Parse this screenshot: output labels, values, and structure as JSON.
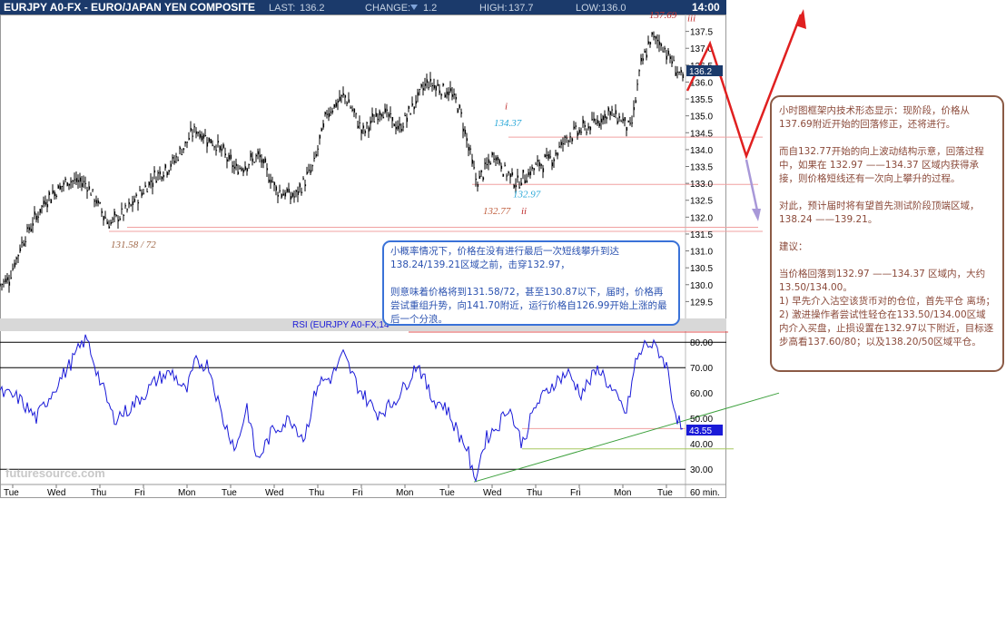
{
  "header": {
    "title": "EURJPY A0-FX - EURO/JAPAN YEN COMPOSITE",
    "last_label": "LAST:",
    "last": "136.2",
    "change_label": "CHANGE:",
    "change": "1.2",
    "high_label": "HIGH:",
    "high": "137.7",
    "low_label": "LOW:",
    "low": "136.0",
    "time": "14:00"
  },
  "chart_data": [
    {
      "type": "candlestick",
      "title": "EURJPY A0-FX - EURO/JAPAN YEN COMPOSITE",
      "ylim": [
        129.0,
        138.0
      ],
      "y_ticks": [
        "137.5",
        "137.0",
        "136.5",
        "136.0",
        "135.5",
        "135.0",
        "134.5",
        "134.0",
        "133.5",
        "133.0",
        "132.5",
        "132.0",
        "131.5",
        "131.0",
        "130.5",
        "130.0",
        "129.5"
      ],
      "last_price": "136.2",
      "path": [
        {
          "i": 0,
          "y": 130.0
        },
        {
          "i": 10,
          "y": 130.2
        },
        {
          "i": 25,
          "y": 131.3
        },
        {
          "i": 50,
          "y": 132.5
        },
        {
          "i": 75,
          "y": 133.1
        },
        {
          "i": 95,
          "y": 133.0
        },
        {
          "i": 120,
          "y": 131.8
        },
        {
          "i": 140,
          "y": 132.2
        },
        {
          "i": 170,
          "y": 133.2
        },
        {
          "i": 190,
          "y": 133.6
        },
        {
          "i": 215,
          "y": 134.6
        },
        {
          "i": 240,
          "y": 134.1
        },
        {
          "i": 260,
          "y": 133.4
        },
        {
          "i": 285,
          "y": 133.8
        },
        {
          "i": 305,
          "y": 132.8
        },
        {
          "i": 325,
          "y": 132.6
        },
        {
          "i": 345,
          "y": 133.5
        },
        {
          "i": 360,
          "y": 135.1
        },
        {
          "i": 380,
          "y": 135.6
        },
        {
          "i": 400,
          "y": 134.5
        },
        {
          "i": 420,
          "y": 135.2
        },
        {
          "i": 440,
          "y": 134.6
        },
        {
          "i": 470,
          "y": 136.0
        },
        {
          "i": 495,
          "y": 135.7
        },
        {
          "i": 505,
          "y": 135.3
        },
        {
          "i": 515,
          "y": 134.2
        },
        {
          "i": 525,
          "y": 133.0
        },
        {
          "i": 545,
          "y": 133.9
        },
        {
          "i": 555,
          "y": 133.4
        },
        {
          "i": 570,
          "y": 133.0
        },
        {
          "i": 590,
          "y": 133.5
        },
        {
          "i": 610,
          "y": 133.8
        },
        {
          "i": 625,
          "y": 134.4
        },
        {
          "i": 650,
          "y": 134.7
        },
        {
          "i": 670,
          "y": 135.1
        },
        {
          "i": 685,
          "y": 134.9
        },
        {
          "i": 695,
          "y": 134.6
        },
        {
          "i": 705,
          "y": 136.4
        },
        {
          "i": 717,
          "y": 137.3
        },
        {
          "i": 727,
          "y": 137.2
        },
        {
          "i": 740,
          "y": 136.6
        },
        {
          "i": 752,
          "y": 136.1
        }
      ],
      "h_levels": [
        134.37,
        132.97,
        131.7,
        131.58
      ],
      "annotations": [
        {
          "text": "i",
          "y": 135.3,
          "color": "#c03030"
        },
        {
          "text": "134.37",
          "y": 134.8,
          "color": "#2aa8d8"
        },
        {
          "text": "132.97",
          "y": 132.7,
          "color": "#2aa8d8"
        },
        {
          "text": "132.77",
          "y": 132.2,
          "color": "#c06040"
        },
        {
          "text": "ii",
          "y": 132.2,
          "color": "#c03030"
        },
        {
          "text": "131.58 / 72",
          "y": 131.2,
          "color": "#a06848"
        },
        {
          "text": "137.69",
          "y": 138.0,
          "color": "#c03030"
        },
        {
          "text": "iii",
          "y": 137.9,
          "color": "#c03030"
        }
      ]
    },
    {
      "type": "line",
      "title": "RSI (EURJPY A0-FX,14",
      "ylim": [
        24.0,
        84.0
      ],
      "y_ticks": [
        "80.00",
        "70.00",
        "60.00",
        "50.00",
        "40.00",
        "30.00"
      ],
      "last_value": "43.55",
      "path": [
        {
          "i": 0,
          "y": 60
        },
        {
          "i": 20,
          "y": 58
        },
        {
          "i": 40,
          "y": 50
        },
        {
          "i": 60,
          "y": 62
        },
        {
          "i": 75,
          "y": 70
        },
        {
          "i": 85,
          "y": 76
        },
        {
          "i": 95,
          "y": 82
        },
        {
          "i": 110,
          "y": 65
        },
        {
          "i": 125,
          "y": 50
        },
        {
          "i": 140,
          "y": 53
        },
        {
          "i": 160,
          "y": 60
        },
        {
          "i": 175,
          "y": 66
        },
        {
          "i": 190,
          "y": 68
        },
        {
          "i": 205,
          "y": 60
        },
        {
          "i": 215,
          "y": 72
        },
        {
          "i": 230,
          "y": 71
        },
        {
          "i": 245,
          "y": 50
        },
        {
          "i": 260,
          "y": 38
        },
        {
          "i": 272,
          "y": 55
        },
        {
          "i": 283,
          "y": 33
        },
        {
          "i": 300,
          "y": 45
        },
        {
          "i": 320,
          "y": 50
        },
        {
          "i": 335,
          "y": 42
        },
        {
          "i": 350,
          "y": 64
        },
        {
          "i": 365,
          "y": 66
        },
        {
          "i": 378,
          "y": 75
        },
        {
          "i": 395,
          "y": 62
        },
        {
          "i": 415,
          "y": 52
        },
        {
          "i": 430,
          "y": 55
        },
        {
          "i": 445,
          "y": 62
        },
        {
          "i": 460,
          "y": 72
        },
        {
          "i": 475,
          "y": 58
        },
        {
          "i": 490,
          "y": 55
        },
        {
          "i": 505,
          "y": 44
        },
        {
          "i": 515,
          "y": 38
        },
        {
          "i": 522,
          "y": 25
        },
        {
          "i": 535,
          "y": 42
        },
        {
          "i": 550,
          "y": 48
        },
        {
          "i": 560,
          "y": 55
        },
        {
          "i": 575,
          "y": 40
        },
        {
          "i": 590,
          "y": 55
        },
        {
          "i": 610,
          "y": 64
        },
        {
          "i": 625,
          "y": 68
        },
        {
          "i": 640,
          "y": 60
        },
        {
          "i": 660,
          "y": 70
        },
        {
          "i": 675,
          "y": 60
        },
        {
          "i": 690,
          "y": 52
        },
        {
          "i": 700,
          "y": 72
        },
        {
          "i": 712,
          "y": 80
        },
        {
          "i": 725,
          "y": 77
        },
        {
          "i": 735,
          "y": 70
        },
        {
          "i": 742,
          "y": 55
        },
        {
          "i": 752,
          "y": 44
        }
      ],
      "h_levels": [
        80.0,
        70.0,
        30.0,
        46.0,
        38.0
      ]
    }
  ],
  "x_axis": {
    "labels": [
      "Tue",
      "Wed",
      "Thu",
      "Fri",
      "Mon",
      "Tue",
      "Wed",
      "Thu",
      "Fri",
      "Mon",
      "Tue",
      "Wed",
      "Thu",
      "Fri",
      "Mon",
      "Tue"
    ],
    "interval": "60 min."
  },
  "watermark": "futuresource.com",
  "note_left": [
    "小概率情况下，价格在没有进行最后一次短线攀升到达138.24/139.21区域之前，击穿132.97，",
    "则意味着价格将到131.58/72，甚至130.87以下，届时，价格再尝试重组升势，向141.70附近，运行价格自126.99开始上涨的最后一个分浪。"
  ],
  "note_right": [
    "小时图框架内技术形态显示：现阶段，价格从137.69附近开始的回落修正，还将进行。",
    "而自132.77开始的向上波动结构示意，回落过程中，如果在 132.97 ——134.37 区域内获得承接，则价格短线还有一次向上攀升的过程。",
    "对此，预计届时将有望首先测试阶段顶端区域，138.24 ——139.21。",
    "建议：",
    "当价格回落到132.97 ——134.37 区域内，大约13.50/134.00。\n1) 早先介入沽空该货币对的仓位，首先平仓 离场；\n2) 激进操作者尝试性轻仓在133.50/134.00区域内介入买盘，止损设置在132.97以下附近，目标逐步高看137.60/80；以及138.20/50区域平仓。"
  ],
  "colors": {
    "header_bg": "#1b3a6b",
    "price": "#000000",
    "rsi": "#1a1ad8",
    "trend": "#3ca03c",
    "forecast": "#e02020",
    "forecast_alt": "#a898d8",
    "level": "#f0a0a0"
  }
}
